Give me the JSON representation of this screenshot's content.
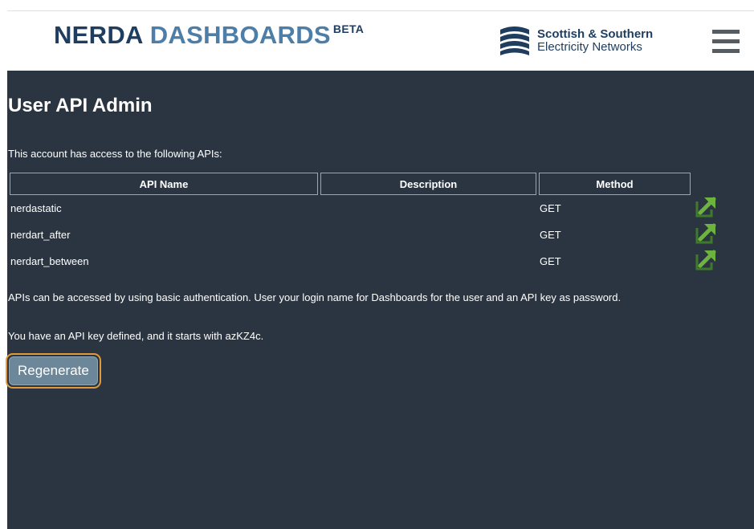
{
  "header": {
    "brand_part1": "NERDA",
    "brand_part2": "DASHBOARDS",
    "brand_beta": "BETA",
    "partner_line1": "Scottish & Southern",
    "partner_line2": "Electricity Networks",
    "menu_icon": "hamburger-menu-icon"
  },
  "page": {
    "title": "User API Admin",
    "intro": "This account has access to the following APIs:",
    "auth_note": "APIs can be accessed by using basic authentication. User your login name for Dashboards for the user and an API key as password.",
    "key_note": "You have an API key defined, and it starts with azKZ4c.",
    "regenerate_label": "Regenerate"
  },
  "table": {
    "headers": [
      "API Name",
      "Description",
      "Method"
    ],
    "rows": [
      {
        "name": "nerdastatic",
        "description": "",
        "method": "GET",
        "link_icon": "external-link-icon"
      },
      {
        "name": "nerdart_after",
        "description": "",
        "method": "GET",
        "link_icon": "external-link-icon"
      },
      {
        "name": "nerdart_between",
        "description": "",
        "method": "GET",
        "link_icon": "external-link-icon"
      }
    ]
  },
  "colors": {
    "background": "#2b3541",
    "brand_dark": "#1e3d5f",
    "brand_light": "#4d7ea7",
    "link_icon": "#6db33f",
    "button": "#6b8799",
    "focus_outline": "#e09a3a"
  }
}
